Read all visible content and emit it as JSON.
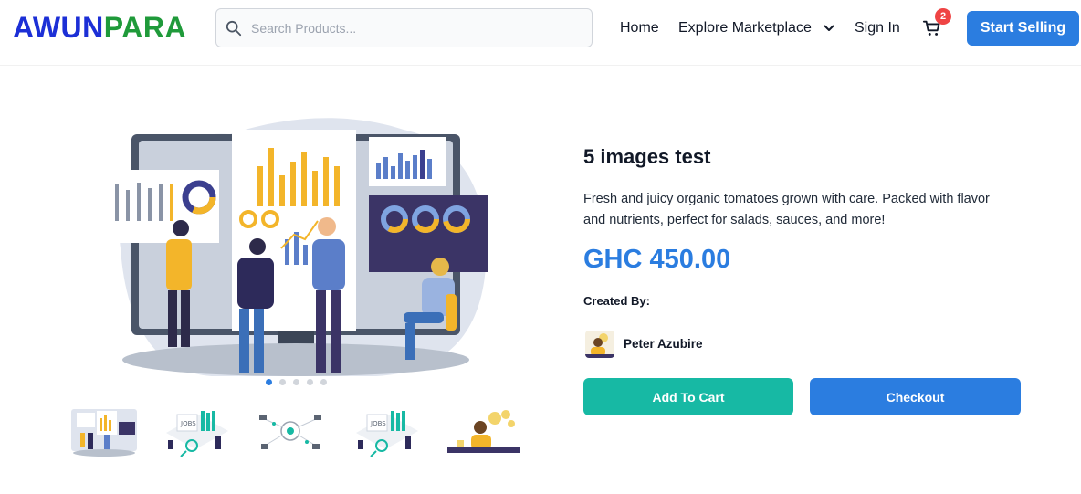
{
  "brand": {
    "logo_part1": "AWUN",
    "logo_part2": "PARA",
    "color_part1": "#1c2fd6",
    "color_part2": "#1f9a3a"
  },
  "search": {
    "placeholder": "Search Products...",
    "value": "",
    "icon": "search-icon"
  },
  "nav": {
    "home": "Home",
    "explore": "Explore Marketplace",
    "explore_icon": "chevron-down-icon",
    "signin": "Sign In",
    "cart_icon": "cart-icon",
    "cart_count": "2",
    "start_selling": "Start Selling"
  },
  "gallery": {
    "image_count": 5,
    "active_index": 0,
    "thumbnails": [
      "thumbnail-analytics-team",
      "thumbnail-jobs-board",
      "thumbnail-network-diagram",
      "thumbnail-jobs-board-2",
      "thumbnail-person-ideas"
    ]
  },
  "product": {
    "title": "5 images test",
    "description": "Fresh and juicy organic tomatoes grown with care. Packed with flavor and nutrients, perfect for salads, sauces, and more!",
    "price": "GHC 450.00",
    "created_by_label": "Created By:",
    "creator_name": "Peter Azubire"
  },
  "actions": {
    "add_to_cart": "Add To Cart",
    "checkout": "Checkout"
  },
  "colors": {
    "primary": "#2b7de0",
    "teal": "#17b9a4",
    "badge": "#ef4444"
  }
}
